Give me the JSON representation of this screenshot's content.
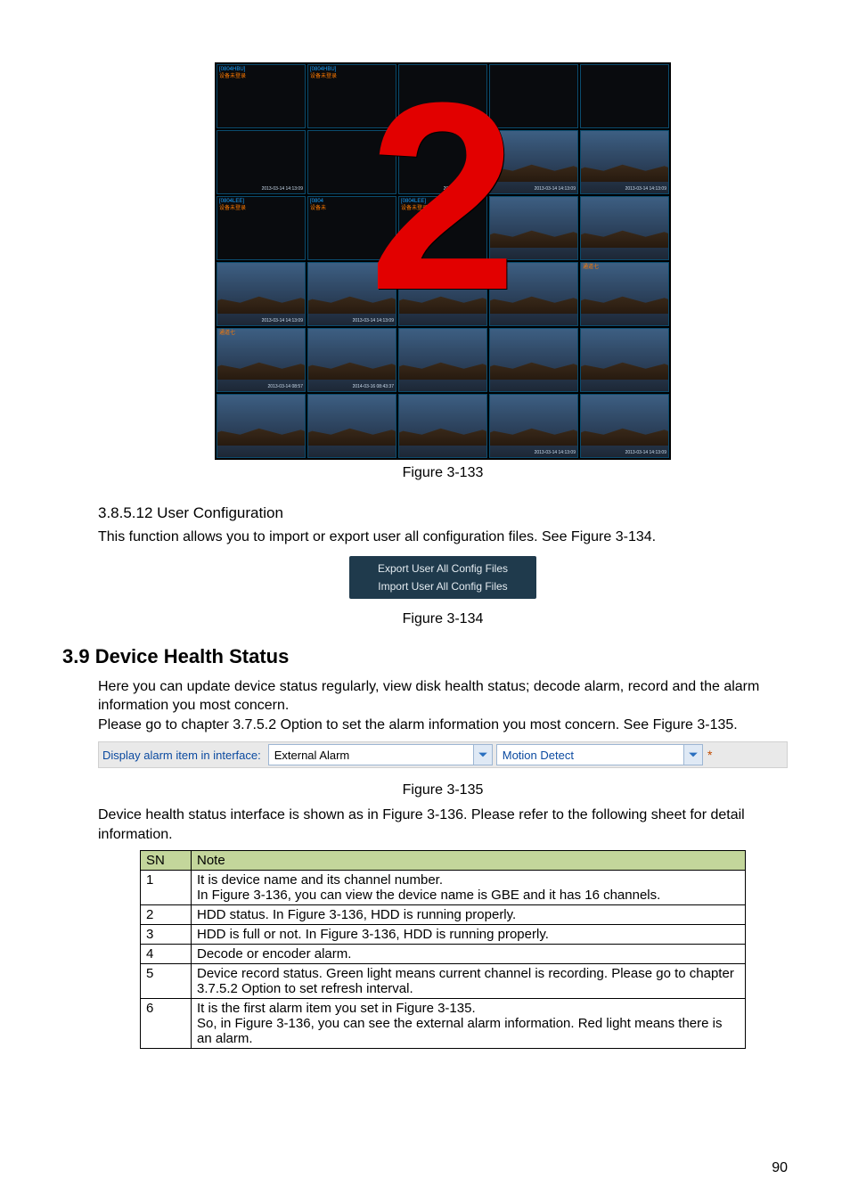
{
  "page_number": "90",
  "fig133": {
    "caption": "Figure 3-133",
    "overlay": "2",
    "sample_cn_labels": [
      "[0804HBU]",
      "设备未登录",
      "[0804LEE]",
      "设备未登录",
      "通道七",
      "通道八"
    ],
    "sample_ts": [
      "2013-03-14 14:13:09",
      "2013-03-14 08:57"
    ]
  },
  "sec_usercfg": {
    "heading": "3.8.5.12   User Configuration",
    "body": "This function allows you to import or export user all configuration files. See Figure 3-134.",
    "box_line1": "Export User All Config Files",
    "box_line2": "Import User All Config Files",
    "fig_caption": "Figure 3-134"
  },
  "sec_health": {
    "heading": "3.9   Device Health Status",
    "p1": "Here you can update device status regularly, view disk health status; decode alarm, record and the alarm information you most concern.",
    "p2": "Please go to chapter 3.7.5.2 Option to set the alarm information you most concern. See Figure 3-135.",
    "alarm_label": "Display alarm item in interface:",
    "alarm_dd1": "External Alarm",
    "alarm_dd2": "Motion Detect",
    "alarm_star": "*",
    "fig135_caption": "Figure 3-135",
    "p3": "Device health status interface is shown as in Figure 3-136. Please refer to the following sheet for detail information."
  },
  "table": {
    "headers": [
      "SN",
      "Note"
    ],
    "rows": [
      {
        "sn": "1",
        "note": "It is device name and its channel number.\nIn Figure 3-136, you can view the device name is GBE and it has 16 channels."
      },
      {
        "sn": "2",
        "note": "HDD status. In Figure 3-136, HDD is running properly."
      },
      {
        "sn": "3",
        "note": "HDD is full or not. In Figure 3-136, HDD is running properly."
      },
      {
        "sn": "4",
        "note": "Decode or encoder alarm."
      },
      {
        "sn": "5",
        "note": "Device record status. Green light means current channel is recording. Please go to chapter 3.7.5.2 Option to set refresh interval."
      },
      {
        "sn": "6",
        "note": "It is the first alarm item you set in Figure 3-135.\nSo, in Figure 3-136, you can see the external alarm information. Red light means there is an alarm."
      }
    ]
  }
}
